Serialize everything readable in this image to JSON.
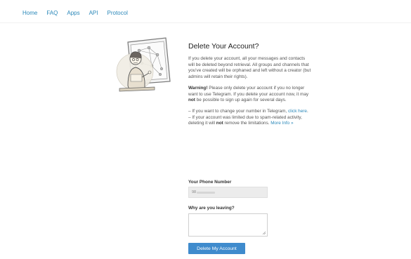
{
  "nav": {
    "items": [
      "Home",
      "FAQ",
      "Apps",
      "API",
      "Protocol"
    ]
  },
  "article": {
    "title": "Delete Your Account?",
    "para1": "If you delete your account, all your messages and contacts will be deleted beyond retrieval. All groups and channels that you've created will be orphaned and left without a creator (but admins will retain their rights).",
    "warning_label": "Warning!",
    "warning_text_1": " Please only delete your account if you no longer want to use Telegram. If you delete your account now, it may ",
    "warning_not": "not",
    "warning_text_2": " be possible to sign up again for several days.",
    "change_number_text": "– If you want to change your number in Telegram, ",
    "change_number_link": "click here",
    "change_number_end": ".",
    "limited_text_1": "– If your account was limited due to spam-related activity, deleting it will ",
    "limited_not": "not",
    "limited_text_2": " remove the limitations. ",
    "more_info_link": "More Info »"
  },
  "form": {
    "phone_label": "Your Phone Number",
    "phone_value": "98",
    "reason_label": "Why are you leaving?",
    "reason_value": "",
    "submit_label": "Delete My Account"
  },
  "colors": {
    "link": "#2b88b9",
    "button": "#3f8bcd",
    "field_bg": "#ececec"
  }
}
